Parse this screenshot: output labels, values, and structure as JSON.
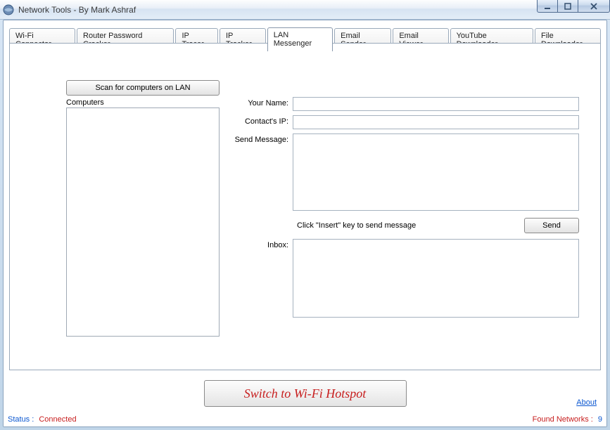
{
  "window": {
    "title": "Network Tools - By Mark Ashraf"
  },
  "tabs": [
    {
      "label": "Wi-Fi Connector"
    },
    {
      "label": "Router Password Cracker"
    },
    {
      "label": "IP Tracer"
    },
    {
      "label": "IP Tracker"
    },
    {
      "label": "LAN Messenger"
    },
    {
      "label": "Email Sender"
    },
    {
      "label": "Email Viewer"
    },
    {
      "label": "YouTube Downloader"
    },
    {
      "label": "File Downloader"
    }
  ],
  "active_tab_index": 4,
  "lan_messenger": {
    "scan_button": "Scan for computers on LAN",
    "computers_label": "Computers",
    "your_name_label": "Your Name:",
    "your_name_value": "",
    "contact_ip_label": "Contact's IP:",
    "contact_ip_value": "",
    "send_message_label": "Send Message:",
    "send_message_value": "",
    "hint": "Click \"Insert\" key to send message",
    "send_button": "Send",
    "inbox_label": "Inbox:",
    "inbox_value": ""
  },
  "hotspot_button": "Switch to Wi-Fi Hotspot",
  "about_link": "About",
  "status": {
    "status_label": "Status :",
    "status_value": "Connected",
    "networks_label": "Found Networks :",
    "networks_value": "9"
  }
}
